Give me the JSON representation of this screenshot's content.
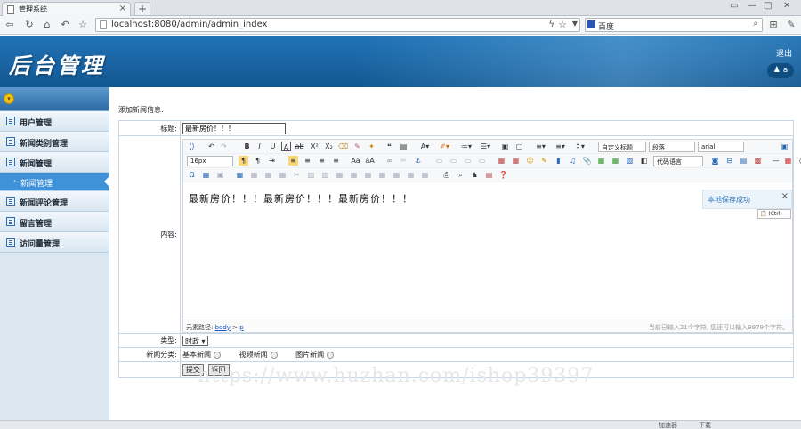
{
  "browser": {
    "tab_title": "管理系统",
    "new_tab_symbol": "+",
    "url": "localhost:8080/admin/admin_index",
    "search_engine": "百度",
    "win_controls": [
      "▭",
      "—",
      "□"
    ]
  },
  "header": {
    "logo_text": "后台管理",
    "logout_label": "退出",
    "user_label": "a"
  },
  "sidebar": {
    "items": [
      {
        "label": "用户管理"
      },
      {
        "label": "新闻类别管理"
      },
      {
        "label": "新闻管理"
      },
      {
        "label": "新闻评论管理"
      },
      {
        "label": "留言管理"
      },
      {
        "label": "访问量管理"
      }
    ],
    "active_sub": "新闻管理"
  },
  "form": {
    "section_title": "添加新闻信息:",
    "title_label": "标题:",
    "title_value": "最新房价！！！",
    "content_label": "内容:",
    "type_label": "类型:",
    "type_value": "时政",
    "category_label": "新闻分类:",
    "category_options": [
      "基本新闻",
      "视频新闻",
      "图片新闻"
    ],
    "submit_label": "提交",
    "back_label": "返回"
  },
  "editor": {
    "font_size": "16px",
    "custom_title": "自定义标题",
    "paragraph": "段落",
    "font_family": "arial",
    "code_lang": "代码语言",
    "body_text": "最新房价！！！最新房价！！！最新房价！！！",
    "path_label": "元素路径:",
    "path_body": "body",
    "path_sep": ">",
    "path_p": "p",
    "char_count": "当前已输入21个字符, 您还可以输入9979个字符。",
    "save_tip": "本地保存成功",
    "paste_tip": "(Ctrl)"
  },
  "watermark": "https://www.huzhan.com/ishop39397",
  "status": {
    "speed": "加速器",
    "download": "下载"
  }
}
